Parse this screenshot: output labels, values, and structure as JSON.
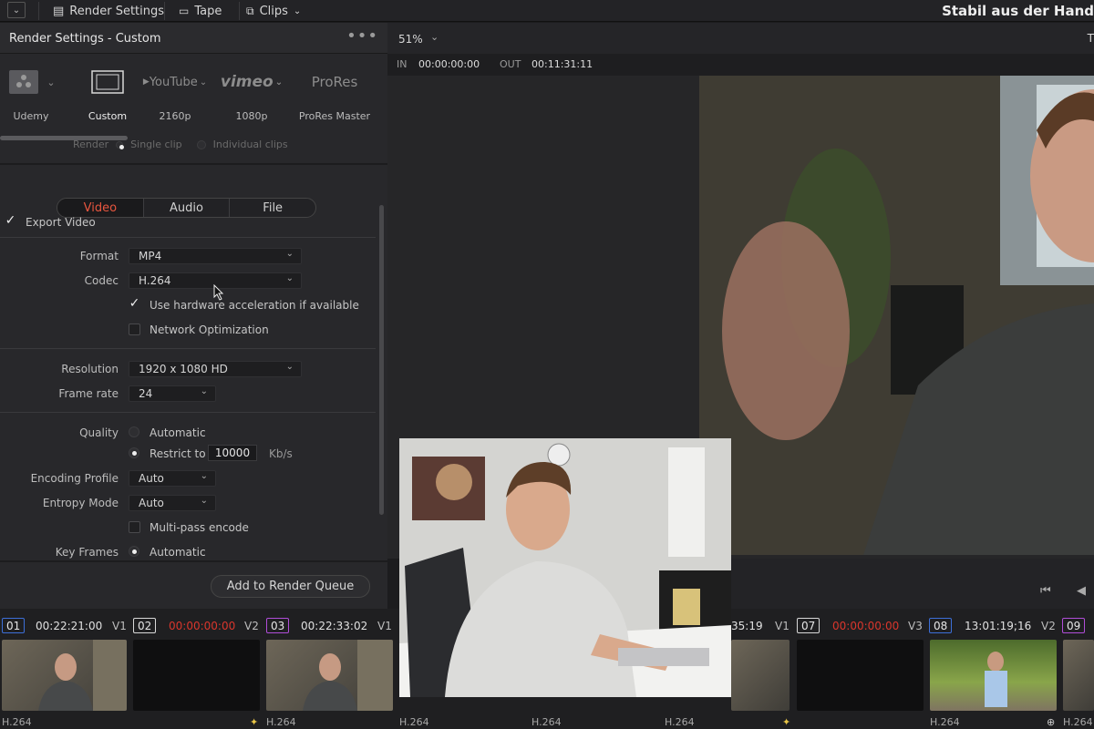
{
  "topbar": {
    "render_settings": "Render Settings",
    "tape": "Tape",
    "clips": "Clips",
    "project_title": "Stabil aus der Hand"
  },
  "left_panel": {
    "title": "Render Settings - Custom",
    "presets": [
      {
        "label": "Udemy"
      },
      {
        "label": "Custom"
      },
      {
        "label": "2160p",
        "brand": "YouTube"
      },
      {
        "label": "1080p",
        "brand": "vimeo"
      },
      {
        "label": "ProRes Master",
        "brand": "ProRes"
      }
    ],
    "render_label": "Render",
    "single_clip": "Single clip",
    "individual_clips": "Individual clips",
    "tabs": [
      "Video",
      "Audio",
      "File"
    ],
    "export_video": "Export Video",
    "format_label": "Format",
    "format_value": "MP4",
    "codec_label": "Codec",
    "codec_value": "H.264",
    "hw_accel": "Use hardware acceleration if available",
    "network_opt": "Network Optimization",
    "resolution_label": "Resolution",
    "resolution_value": "1920 x 1080 HD",
    "framerate_label": "Frame rate",
    "framerate_value": "24",
    "quality_label": "Quality",
    "quality_auto": "Automatic",
    "restrict_to": "Restrict to",
    "restrict_value": "10000",
    "restrict_unit": "Kb/s",
    "encoding_label": "Encoding Profile",
    "encoding_value": "Auto",
    "entropy_label": "Entropy Mode",
    "entropy_value": "Auto",
    "multipass": "Multi-pass encode",
    "keyframes_label": "Key Frames",
    "keyframes_value": "Automatic",
    "queue_button": "Add to Render Queue"
  },
  "viewer": {
    "zoom": "51%",
    "in_label": "IN",
    "in_tc": "00:00:00:00",
    "out_label": "OUT",
    "out_tc": "00:11:31:11",
    "right_mark": "T"
  },
  "timeline": {
    "clips": [
      {
        "num": "01",
        "tc": "00:22:21:00",
        "track": "V1",
        "codec": "H.264",
        "color": "#3d6fd8"
      },
      {
        "num": "02",
        "tc": "00:00:00:00",
        "track": "V2",
        "color": "#d8d8d8",
        "tc_red": true
      },
      {
        "num": "03",
        "tc": "00:22:33:02",
        "track": "V1",
        "codec": "H.264",
        "color": "#b04dd8"
      },
      {
        "tc": "35:19",
        "track": "V1",
        "codec": "H.264"
      },
      {
        "num": "07",
        "tc": "00:00:00:00",
        "track": "V3",
        "color": "#d8d8d8",
        "tc_red": true
      },
      {
        "num": "08",
        "tc": "13:01:19;16",
        "track": "V2",
        "codec": "H.264",
        "color": "#3d6fd8"
      },
      {
        "num": "09",
        "color": "#b04dd8"
      }
    ],
    "extra_codecs": [
      "H.264",
      "H.264",
      "H.264"
    ]
  }
}
